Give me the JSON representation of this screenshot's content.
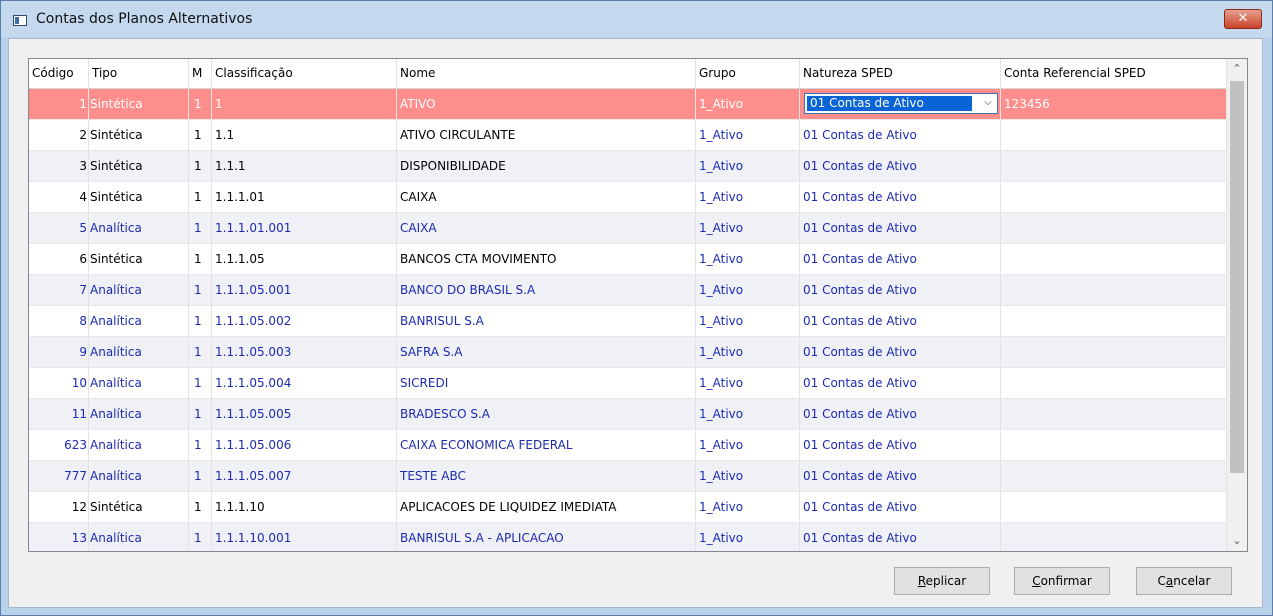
{
  "window": {
    "title": "Contas dos Planos Alternativos",
    "close_glyph": "✕"
  },
  "columns": [
    "Código",
    "Tipo",
    "M",
    "Classificação",
    "Nome",
    "Grupo",
    "Natureza SPED",
    "Conta Referencial SPED"
  ],
  "selected_row": {
    "codigo": "1",
    "tipo": "Sintética",
    "m": "1",
    "classificacao": "1",
    "nome": "ATIVO",
    "grupo": "1_Ativo",
    "natureza": "01 Contas de Ativo",
    "conta_ref": "123456"
  },
  "rows": [
    {
      "codigo": "2",
      "tipo": "Sintética",
      "m": "1",
      "classificacao": "1.1",
      "nome": "ATIVO CIRCULANTE",
      "grupo": "1_Ativo",
      "natureza": "01 Contas de Ativo",
      "conta_ref": ""
    },
    {
      "codigo": "3",
      "tipo": "Sintética",
      "m": "1",
      "classificacao": "1.1.1",
      "nome": "DISPONIBILIDADE",
      "grupo": "1_Ativo",
      "natureza": "01 Contas de Ativo",
      "conta_ref": ""
    },
    {
      "codigo": "4",
      "tipo": "Sintética",
      "m": "1",
      "classificacao": "1.1.1.01",
      "nome": "CAIXA",
      "grupo": "1_Ativo",
      "natureza": "01 Contas de Ativo",
      "conta_ref": ""
    },
    {
      "codigo": "5",
      "tipo": "Analítica",
      "m": "1",
      "classificacao": "1.1.1.01.001",
      "nome": "CAIXA",
      "grupo": "1_Ativo",
      "natureza": "01 Contas de Ativo",
      "conta_ref": ""
    },
    {
      "codigo": "6",
      "tipo": "Sintética",
      "m": "1",
      "classificacao": "1.1.1.05",
      "nome": "BANCOS CTA MOVIMENTO",
      "grupo": "1_Ativo",
      "natureza": "01 Contas de Ativo",
      "conta_ref": ""
    },
    {
      "codigo": "7",
      "tipo": "Analítica",
      "m": "1",
      "classificacao": "1.1.1.05.001",
      "nome": "BANCO DO BRASIL S.A",
      "grupo": "1_Ativo",
      "natureza": "01 Contas de Ativo",
      "conta_ref": ""
    },
    {
      "codigo": "8",
      "tipo": "Analítica",
      "m": "1",
      "classificacao": "1.1.1.05.002",
      "nome": "BANRISUL S.A",
      "grupo": "1_Ativo",
      "natureza": "01 Contas de Ativo",
      "conta_ref": ""
    },
    {
      "codigo": "9",
      "tipo": "Analítica",
      "m": "1",
      "classificacao": "1.1.1.05.003",
      "nome": "SAFRA S.A",
      "grupo": "1_Ativo",
      "natureza": "01 Contas de Ativo",
      "conta_ref": ""
    },
    {
      "codigo": "10",
      "tipo": "Analítica",
      "m": "1",
      "classificacao": "1.1.1.05.004",
      "nome": "SICREDI",
      "grupo": "1_Ativo",
      "natureza": "01 Contas de Ativo",
      "conta_ref": ""
    },
    {
      "codigo": "11",
      "tipo": "Analítica",
      "m": "1",
      "classificacao": "1.1.1.05.005",
      "nome": "BRADESCO S.A",
      "grupo": "1_Ativo",
      "natureza": "01 Contas de Ativo",
      "conta_ref": ""
    },
    {
      "codigo": "623",
      "tipo": "Analítica",
      "m": "1",
      "classificacao": "1.1.1.05.006",
      "nome": "CAIXA ECONOMICA FEDERAL",
      "grupo": "1_Ativo",
      "natureza": "01 Contas de Ativo",
      "conta_ref": ""
    },
    {
      "codigo": "777",
      "tipo": "Analítica",
      "m": "1",
      "classificacao": "1.1.1.05.007",
      "nome": "TESTE ABC",
      "grupo": "1_Ativo",
      "natureza": "01 Contas de Ativo",
      "conta_ref": ""
    },
    {
      "codigo": "12",
      "tipo": "Sintética",
      "m": "1",
      "classificacao": "1.1.1.10",
      "nome": "APLICACOES DE LIQUIDEZ IMEDIATA",
      "grupo": "1_Ativo",
      "natureza": "01 Contas de Ativo",
      "conta_ref": ""
    },
    {
      "codigo": "13",
      "tipo": "Analítica",
      "m": "1",
      "classificacao": "1.1.1.10.001",
      "nome": "BANRISUL S.A - APLICACAO",
      "grupo": "1_Ativo",
      "natureza": "01 Contas de Ativo",
      "conta_ref": ""
    }
  ],
  "colors": {
    "selected_row": "#fd8e8c",
    "analytic_text": "#1d2bb0",
    "alt_row": "#f0f0f7"
  },
  "buttons": {
    "replicar": {
      "hotkey": "R",
      "rest": "eplicar"
    },
    "confirmar": {
      "hotkey": "C",
      "rest": "onfirmar"
    },
    "cancelar": {
      "pre": "C",
      "hotkey": "a",
      "rest": "ncelar"
    }
  },
  "scrollbar": {
    "up_glyph": "▲",
    "down_glyph": "▼"
  }
}
